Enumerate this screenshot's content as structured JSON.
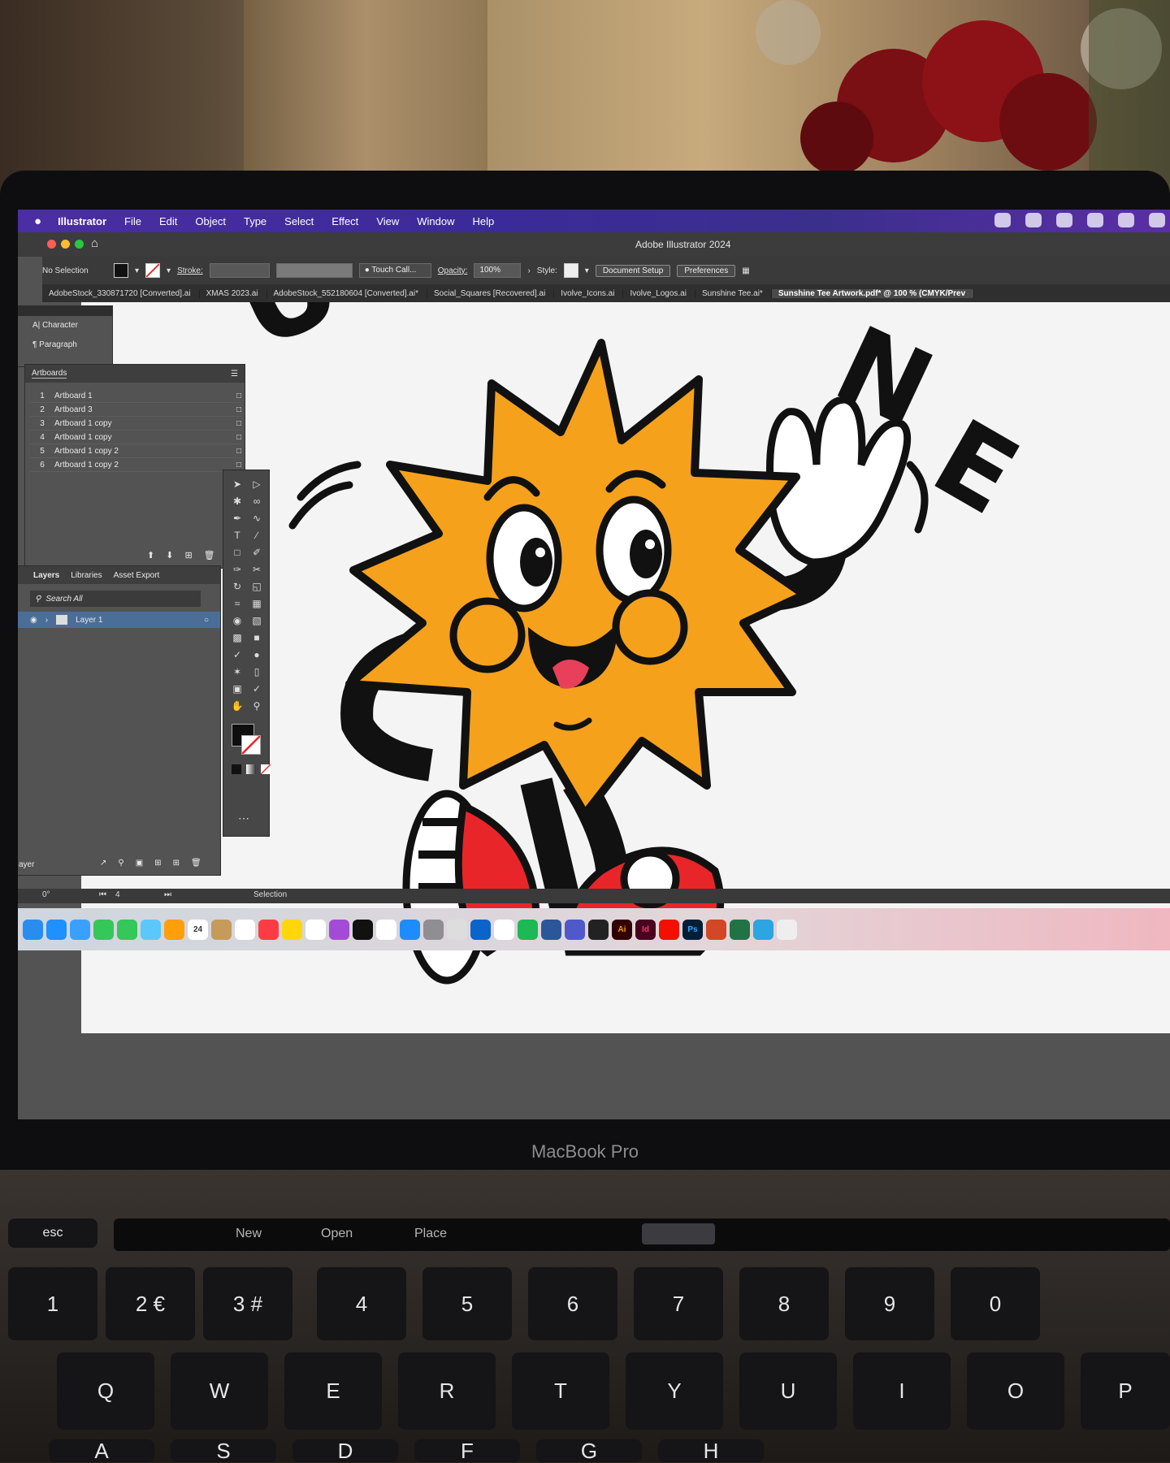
{
  "menubar": {
    "apple": "",
    "app_name": "Illustrator",
    "items": [
      "File",
      "Edit",
      "Object",
      "Type",
      "Select",
      "Effect",
      "View",
      "Window",
      "Help"
    ]
  },
  "window": {
    "title": "Adobe Illustrator 2024"
  },
  "control_bar": {
    "selection": "No Selection",
    "stroke_label": "Stroke:",
    "brush": "Touch Call...",
    "opacity_label": "Opacity:",
    "opacity_value": "100%",
    "style_label": "Style:",
    "document_setup": "Document Setup",
    "preferences": "Preferences"
  },
  "tabs": [
    "AdobeStock_330871720 [Converted].ai",
    "XMAS 2023.ai",
    "AdobeStock_552180604 [Converted].ai*",
    "Social_Squares [Recovered].ai",
    "Ivolve_Icons.ai",
    "Ivolve_Logos.ai",
    "Sunshine Tee.ai*",
    "Sunshine Tee Artwork.pdf* @ 100 % (CMYK/Prev"
  ],
  "char_panel": {
    "items": [
      "Character",
      "Paragraph"
    ]
  },
  "artboards": {
    "title": "Artboards",
    "rows": [
      {
        "num": "1",
        "name": "Artboard 1"
      },
      {
        "num": "2",
        "name": "Artboard 3"
      },
      {
        "num": "3",
        "name": "Artboard 1 copy"
      },
      {
        "num": "4",
        "name": "Artboard 1 copy"
      },
      {
        "num": "5",
        "name": "Artboard 1 copy 2"
      },
      {
        "num": "6",
        "name": "Artboard 1 copy 2"
      }
    ]
  },
  "layers": {
    "tabs": [
      "Layers",
      "Libraries",
      "Asset Export"
    ],
    "search_placeholder": "Search All",
    "layer_name": "Layer 1",
    "footer": "ayer"
  },
  "status": {
    "rotation": "0°",
    "artboard": "4",
    "tool": "Selection"
  },
  "dock": {
    "calendar_day": "24"
  },
  "laptop": {
    "brand": "MacBook Pro"
  },
  "touchbar": {
    "items": [
      "New",
      "Open",
      "Place"
    ],
    "esc": "esc"
  },
  "keys": {
    "row1": [
      "1",
      "2 €",
      "3 #",
      "4",
      "5",
      "6",
      "7",
      "8",
      "9",
      "0"
    ],
    "row1_top": [
      "!",
      "@",
      "£",
      "$",
      "%",
      "^",
      "&",
      "*",
      "(",
      ")"
    ],
    "row2": [
      "Q",
      "W",
      "E",
      "R",
      "T",
      "Y",
      "U",
      "I",
      "O",
      "P"
    ],
    "row3": [
      "A",
      "S",
      "D",
      "F",
      "G",
      "H"
    ]
  },
  "colors": {
    "menubar": "#3b2a9a",
    "sun": "#f5a11c",
    "shoe": "#e8262a",
    "tongue": "#e8405a",
    "layer_highlight": "#4a6e98"
  },
  "artwork_letters": [
    "U",
    "N",
    "E"
  ]
}
